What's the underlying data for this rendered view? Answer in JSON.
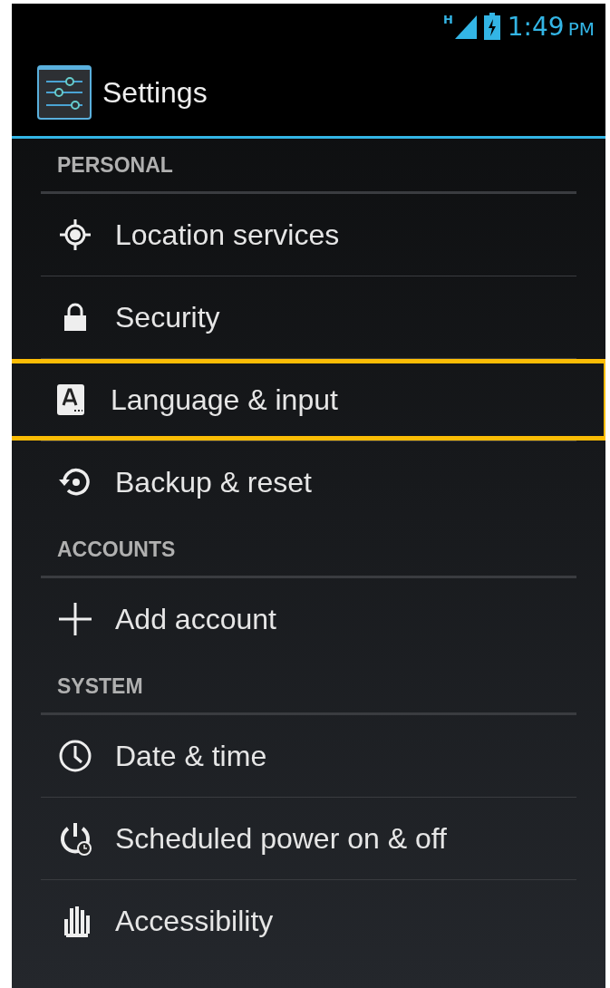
{
  "status_bar": {
    "network": "H",
    "time": "1:49",
    "ampm": "PM"
  },
  "action_bar": {
    "title": "Settings"
  },
  "sections": [
    {
      "title": "PERSONAL",
      "items": [
        {
          "label": "Location services",
          "highlighted": false
        },
        {
          "label": "Security",
          "highlighted": false
        },
        {
          "label": "Language & input",
          "highlighted": true
        },
        {
          "label": "Backup & reset",
          "highlighted": false
        }
      ]
    },
    {
      "title": "ACCOUNTS",
      "items": [
        {
          "label": "Add account",
          "highlighted": false
        }
      ]
    },
    {
      "title": "SYSTEM",
      "items": [
        {
          "label": "Date & time",
          "highlighted": false
        },
        {
          "label": "Scheduled power on & off",
          "highlighted": false
        },
        {
          "label": "Accessibility",
          "highlighted": false
        }
      ]
    }
  ]
}
